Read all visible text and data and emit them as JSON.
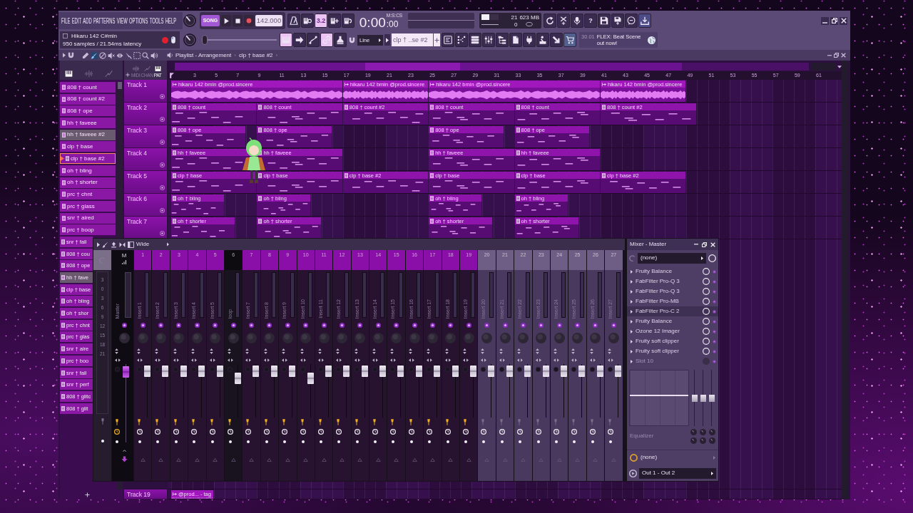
{
  "toolbar": {
    "menu": [
      "FILE",
      "EDIT",
      "ADD",
      "PATTERNS",
      "VIEW",
      "OPTIONS",
      "TOOLS",
      "HELP"
    ],
    "mode": {
      "label": "SONG",
      "selected": true
    },
    "tempo": "142.000",
    "record_buttons": [
      {
        "kind": "metronome",
        "on": false
      },
      {
        "kind": "wait-input",
        "on": false
      },
      {
        "kind": "countdown",
        "label": "3.2",
        "on": true
      },
      {
        "kind": "step-edit",
        "on": false
      },
      {
        "kind": "loop-record",
        "on": false
      }
    ],
    "time": {
      "value": "0:00",
      "fraction": ":00",
      "format": "M:S:CS"
    },
    "cpu_meter": {
      "level": 0.45
    },
    "polyphony": "21",
    "memory": "623 MB",
    "voices": "0",
    "tool_buttons": [
      {
        "kind": "undo"
      },
      {
        "kind": "cut"
      },
      {
        "kind": "microphone"
      },
      {
        "kind": "help",
        "label": "?"
      },
      {
        "kind": "save"
      },
      {
        "kind": "save-new"
      },
      {
        "kind": "chat"
      },
      {
        "kind": "download"
      }
    ],
    "hint": {
      "title": "Hikaru 142 C#min",
      "detail": "950 samples / 21.54ms latency"
    },
    "song_position": {
      "level": 0
    },
    "edit_buttons": [
      {
        "kind": "piano-roll",
        "on": true
      },
      {
        "kind": "arrow",
        "on": false
      },
      {
        "kind": "curve",
        "on": false
      },
      {
        "kind": "link",
        "on": true
      },
      {
        "kind": "stamp",
        "on": false
      }
    ],
    "snap": "Line",
    "pattern": "clp † ..se #2",
    "window_buttons": [
      {
        "kind": "playlist"
      },
      {
        "kind": "step-sequencer"
      },
      {
        "kind": "channel-rack"
      },
      {
        "kind": "mixer"
      },
      {
        "kind": "browser"
      },
      {
        "kind": "document"
      },
      {
        "kind": "plug"
      },
      {
        "kind": "figure"
      },
      {
        "kind": "drag"
      },
      {
        "kind": "cart"
      }
    ],
    "news": {
      "date": "30.01",
      "text": "FLEX: Beat Scene out now!"
    }
  },
  "playlist": {
    "tools": [
      {
        "kind": "pencil",
        "selected": false
      },
      {
        "kind": "brush",
        "selected": true
      },
      {
        "kind": "delete",
        "selected": false
      },
      {
        "kind": "mute",
        "selected": false
      },
      {
        "kind": "slip",
        "selected": false
      },
      {
        "kind": "slice",
        "selected": false
      },
      {
        "kind": "select",
        "selected": false
      },
      {
        "kind": "zoom",
        "selected": false
      },
      {
        "kind": "playback",
        "selected": false
      }
    ],
    "breadcrumb": [
      {
        "kind": "crumb",
        "text": "Playlist - Arrangement"
      },
      {
        "kind": "separator",
        "text": "›"
      },
      {
        "kind": "crumb",
        "text": "clp † base #2"
      },
      {
        "kind": "separator",
        "text": "›"
      }
    ],
    "picker_tabs": [
      {
        "kind": "pattern",
        "selected": true
      },
      {
        "kind": "audio",
        "selected": false
      },
      {
        "kind": "automation",
        "selected": false
      }
    ],
    "patterns": [
      {
        "name": "808 † count",
        "selected": false,
        "current": false
      },
      {
        "name": "808 † count #2",
        "selected": false,
        "current": false
      },
      {
        "name": "808 † ope",
        "selected": false,
        "current": false
      },
      {
        "name": "hh † faveee",
        "selected": false,
        "current": false
      },
      {
        "name": "hh † faveee #2",
        "selected": true,
        "current": false
      },
      {
        "name": "clp † base",
        "selected": false,
        "current": false
      },
      {
        "name": "clp † base #2",
        "selected": false,
        "current": true
      },
      {
        "name": "oh † bling",
        "selected": false,
        "current": false
      },
      {
        "name": "oh † shorter",
        "selected": false,
        "current": false
      },
      {
        "name": "prc † chnt",
        "selected": false,
        "current": false
      },
      {
        "name": "prc † glass",
        "selected": false,
        "current": false
      },
      {
        "name": "snr † aired",
        "selected": false,
        "current": false
      },
      {
        "name": "prc † boop",
        "selected": false,
        "current": false
      }
    ],
    "patterns_partly_hidden": [
      {
        "name": "snr † fall",
        "selected": false,
        "current": false
      },
      {
        "name": "808 † cou",
        "selected": false,
        "current": false
      },
      {
        "name": "808 † ope",
        "selected": false,
        "current": false
      },
      {
        "name": "hh † fave",
        "selected": true,
        "current": false
      },
      {
        "name": "clp † base",
        "selected": false,
        "current": false
      },
      {
        "name": "oh † bling",
        "selected": false,
        "current": false
      },
      {
        "name": "oh † shor",
        "selected": false,
        "current": false
      },
      {
        "name": "prc † chnt",
        "selected": false,
        "current": false
      },
      {
        "name": "prc † glas",
        "selected": false,
        "current": false
      },
      {
        "name": "snr † aire",
        "selected": false,
        "current": false
      },
      {
        "name": "prc † boo",
        "selected": false,
        "current": false
      },
      {
        "name": "snr † fall",
        "selected": false,
        "current": false
      },
      {
        "name": "snr † perf",
        "selected": false,
        "current": false
      },
      {
        "name": "808 † glitc",
        "selected": false,
        "current": false
      },
      {
        "name": "808 † glit",
        "selected": false,
        "current": false
      }
    ],
    "filters": [
      {
        "kind": "audio",
        "label": "MIDI",
        "selected": false
      },
      {
        "kind": "automation",
        "label": "CHAN",
        "selected": false
      },
      {
        "kind": "pattern",
        "label": "PAT",
        "selected": true
      }
    ],
    "ruler": [
      "3",
      "5",
      "7",
      "9",
      "11",
      "13",
      "15",
      "17",
      "19",
      "21",
      "23",
      "25",
      "27",
      "29",
      "31",
      "33",
      "35",
      "37",
      "39",
      "41",
      "43",
      "45",
      "47",
      "49",
      "51",
      "53",
      "55",
      "57",
      "59",
      "61"
    ],
    "tracks": [
      {
        "name": "Track 1",
        "clips": [
          {
            "kind": "audio",
            "label": "hikaru 142 bmin @prod.sincere"
          },
          {
            "kind": "audio",
            "label": "hikaru 142 bmin @prod.sincere"
          },
          {
            "kind": "audio",
            "label": "hikaru 142 bmin @prod.sincere"
          },
          {
            "kind": "audio",
            "label": "hikaru 142 bmin @prod.sincere"
          }
        ]
      },
      {
        "name": "Track 2",
        "clips": [
          {
            "kind": "pattern",
            "label": "808 † count"
          },
          {
            "kind": "pattern",
            "label": "808 † count"
          },
          {
            "kind": "pattern",
            "label": "808 † count #2"
          },
          {
            "kind": "pattern",
            "label": "808 † count"
          },
          {
            "kind": "pattern",
            "label": "808 † count"
          },
          {
            "kind": "pattern",
            "label": "808 † count #2"
          }
        ]
      },
      {
        "name": "Track 3",
        "clips": [
          {
            "kind": "pattern",
            "label": "808 † ope"
          },
          {
            "kind": "pattern",
            "label": "808 † ope"
          },
          {
            "kind": "pattern",
            "label": "808 † ope"
          },
          {
            "kind": "pattern",
            "label": "808 † ope"
          }
        ]
      },
      {
        "name": "Track 4",
        "clips": [
          {
            "kind": "pattern",
            "label": "hh † faveee"
          },
          {
            "kind": "pattern",
            "label": "hh † faveee"
          },
          {
            "kind": "pattern",
            "label": "hh † faveee"
          },
          {
            "kind": "pattern",
            "label": "hh † faveee"
          }
        ]
      },
      {
        "name": "Track 5",
        "clips": [
          {
            "kind": "pattern",
            "label": "clp † base"
          },
          {
            "kind": "pattern",
            "label": "clp † base"
          },
          {
            "kind": "pattern",
            "label": "clp † base #2"
          },
          {
            "kind": "pattern",
            "label": "clp † base"
          },
          {
            "kind": "pattern",
            "label": "clp † base"
          },
          {
            "kind": "pattern",
            "label": "clp † base #2"
          }
        ]
      },
      {
        "name": "Track 6",
        "clips": [
          {
            "kind": "pattern",
            "label": "oh † bling"
          },
          {
            "kind": "pattern",
            "label": "oh † bling"
          },
          {
            "kind": "pattern",
            "label": "oh † bling"
          },
          {
            "kind": "pattern",
            "label": "oh † bling"
          }
        ]
      },
      {
        "name": "Track 7",
        "clips": [
          {
            "kind": "pattern",
            "label": "oh † shorter"
          },
          {
            "kind": "pattern",
            "label": "oh † shorter"
          },
          {
            "kind": "pattern",
            "label": "oh † shorter"
          },
          {
            "kind": "pattern",
            "label": "oh † shorter"
          }
        ]
      }
    ],
    "bottom_tracks": [
      {
        "name": "Track 19",
        "clips": [
          {
            "kind": "audio",
            "label": "@prod... - tag"
          }
        ]
      }
    ]
  },
  "mixer": {
    "preset": "Wide",
    "scale": [
      "3",
      "0",
      "3",
      "6",
      "9",
      "12",
      "15",
      "18",
      "21"
    ],
    "master": {
      "number": "M",
      "name": "Master",
      "level": 0.97,
      "routed": true
    },
    "inserts": [
      {
        "number": "1",
        "name": "Insert 1",
        "color": "#8a0fa8",
        "level": 0.97,
        "routed": true,
        "selected": false
      },
      {
        "number": "2",
        "name": "Insert 2",
        "color": "#8a0fa8",
        "level": 0.97,
        "routed": true,
        "selected": false
      },
      {
        "number": "3",
        "name": "Insert 3",
        "color": "#8a0fa8",
        "level": 0.97,
        "routed": true,
        "selected": false
      },
      {
        "number": "4",
        "name": "Insert 4",
        "color": "#8a0fa8",
        "level": 0.97,
        "routed": true,
        "selected": false
      },
      {
        "number": "5",
        "name": "Insert 5",
        "color": "#8a0fa8",
        "level": 0.97,
        "routed": true,
        "selected": false
      },
      {
        "number": "6",
        "name": "loop",
        "color": "#0d0b10",
        "level": 0.79,
        "routed": true,
        "selected": false
      },
      {
        "number": "7",
        "name": "Insert 7",
        "color": "#8a0fa8",
        "level": 0.97,
        "routed": true,
        "selected": false
      },
      {
        "number": "8",
        "name": "Insert 8",
        "color": "#8a0fa8",
        "level": 0.97,
        "routed": true,
        "selected": false
      },
      {
        "number": "9",
        "name": "Insert 9",
        "color": "#8a0fa8",
        "level": 0.97,
        "routed": true,
        "selected": false
      },
      {
        "number": "10",
        "name": "Insert 10",
        "color": "#8a0fa8",
        "level": 0.79,
        "routed": true,
        "selected": false
      },
      {
        "number": "11",
        "name": "Insert 11",
        "color": "#8a0fa8",
        "level": 0.97,
        "routed": true,
        "selected": false
      },
      {
        "number": "12",
        "name": "Insert 12",
        "color": "#8a0fa8",
        "level": 0.97,
        "routed": true,
        "selected": false
      },
      {
        "number": "13",
        "name": "Insert 13",
        "color": "#8a0fa8",
        "level": 0.97,
        "routed": true,
        "selected": false
      },
      {
        "number": "14",
        "name": "Insert 14",
        "color": "#8a0fa8",
        "level": 0.97,
        "routed": true,
        "selected": false
      },
      {
        "number": "15",
        "name": "Insert 15",
        "color": "#8a0fa8",
        "level": 0.97,
        "routed": true,
        "selected": false
      },
      {
        "number": "16",
        "name": "Insert 16",
        "color": "#8a0fa8",
        "level": 0.97,
        "routed": true,
        "selected": false
      },
      {
        "number": "17",
        "name": "Insert 17",
        "color": "#8a0fa8",
        "level": 0.97,
        "routed": true,
        "selected": false
      },
      {
        "number": "18",
        "name": "Insert 18",
        "color": "#8a0fa8",
        "level": 0.97,
        "routed": true,
        "selected": false
      },
      {
        "number": "19",
        "name": "Insert 19",
        "color": "#8a0fa8",
        "level": 0.97,
        "routed": true,
        "selected": false
      },
      {
        "number": "20",
        "name": "Insert 20",
        "color": "#6e5e86",
        "level": 0.97,
        "routed": false,
        "selected": true
      },
      {
        "number": "21",
        "name": "Insert 21",
        "color": "#6e5e86",
        "level": 0.97,
        "routed": false,
        "selected": true
      },
      {
        "number": "22",
        "name": "Insert 22",
        "color": "#6e5e86",
        "level": 0.97,
        "routed": false,
        "selected": true
      },
      {
        "number": "23",
        "name": "Insert 23",
        "color": "#6e5e86",
        "level": 0.97,
        "routed": false,
        "selected": true
      },
      {
        "number": "24",
        "name": "Insert 24",
        "color": "#6e5e86",
        "level": 0.97,
        "routed": false,
        "selected": true
      },
      {
        "number": "25",
        "name": "Insert 25",
        "color": "#6e5e86",
        "level": 0.97,
        "routed": false,
        "selected": true
      },
      {
        "number": "26",
        "name": "Insert 26",
        "color": "#6e5e86",
        "level": 0.97,
        "routed": false,
        "selected": true
      },
      {
        "number": "27",
        "name": "Insert 27",
        "color": "#6e5e86",
        "level": 0.97,
        "routed": false,
        "selected": true
      }
    ]
  },
  "channel_panel": {
    "title": "Mixer - Master",
    "input": "(none)",
    "slots": [
      {
        "name": "Fruity Balance",
        "enabled": true,
        "selected": false
      },
      {
        "name": "FabFilter Pro-Q 3",
        "enabled": true,
        "selected": false
      },
      {
        "name": "FabFilter Pro-Q 3",
        "enabled": true,
        "selected": false
      },
      {
        "name": "FabFilter Pro-MB",
        "enabled": true,
        "selected": false
      },
      {
        "name": "FabFilter Pro-C 2",
        "enabled": true,
        "selected": true
      },
      {
        "name": "Fruity Balance",
        "enabled": true,
        "selected": false
      },
      {
        "name": "Ozone 12 Imager",
        "enabled": true,
        "selected": false
      },
      {
        "name": "Fruity soft clipper",
        "enabled": true,
        "selected": false
      },
      {
        "name": "Fruity soft clipper",
        "enabled": true,
        "selected": false
      },
      {
        "name": "Slot 10",
        "enabled": false,
        "selected": false
      }
    ],
    "eq_label": "Equalizer",
    "eq_bands": [
      {
        "level": 0.5
      },
      {
        "level": 0.5
      },
      {
        "level": 0.5
      }
    ],
    "sidechain": "(none)",
    "output": "Out 1 - Out 2"
  }
}
